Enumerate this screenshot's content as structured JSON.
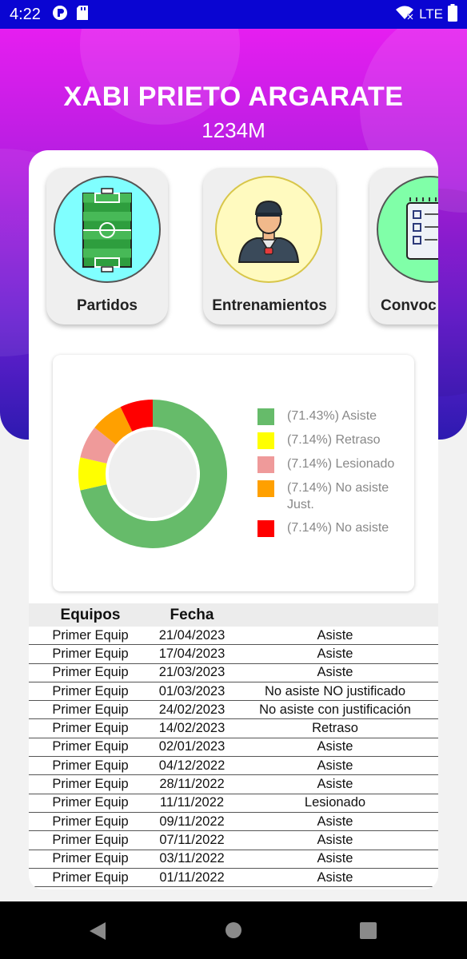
{
  "status_bar": {
    "time": "4:22",
    "network": "LTE",
    "icons": [
      "app-notification-icon",
      "sd-card-icon",
      "wifi-icon",
      "battery-icon"
    ]
  },
  "header": {
    "player_name": "XABI PRIETO ARGARATE",
    "player_code": "1234M",
    "gradient_colors": [
      "#e61ef0",
      "#b21ee0",
      "#6a1fd1",
      "#2d1ab0"
    ]
  },
  "menu": {
    "items": [
      {
        "label": "Partidos",
        "icon": "soccer-field-icon",
        "circle_color": "#80ffff"
      },
      {
        "label": "Entrenamientos",
        "icon": "coach-whistle-icon",
        "circle_color": "#fffabf"
      },
      {
        "label": "Convoc",
        "icon": "checklist-icon",
        "circle_color": "#80ffa8"
      }
    ]
  },
  "chart_data": {
    "type": "pie",
    "categories": [
      "Asiste",
      "Retraso",
      "Lesionado",
      "No asiste Just.",
      "No asiste"
    ],
    "values": [
      71.43,
      7.14,
      7.14,
      7.14,
      7.14
    ],
    "colors": [
      "#66bb6a",
      "#ffff00",
      "#ef9a9a",
      "#ffa000",
      "#ff0000"
    ],
    "legend": [
      "(71.43%) Asiste",
      "(7.14%) Retraso",
      "(7.14%) Lesionado",
      "(7.14%) No asiste Just.",
      "(7.14%) No asiste"
    ],
    "legend_position": "right"
  },
  "table": {
    "headers": [
      "Equipos",
      "Fecha",
      ""
    ],
    "rows": [
      [
        "Primer Equip",
        "21/04/2023",
        "Asiste"
      ],
      [
        "Primer Equip",
        "17/04/2023",
        "Asiste"
      ],
      [
        "Primer Equip",
        "21/03/2023",
        "Asiste"
      ],
      [
        "Primer Equip",
        "01/03/2023",
        "No asiste NO justificado"
      ],
      [
        "Primer Equip",
        "24/02/2023",
        "No asiste con justificación"
      ],
      [
        "Primer Equip",
        "14/02/2023",
        "Retraso"
      ],
      [
        "Primer Equip",
        "02/01/2023",
        "Asiste"
      ],
      [
        "Primer Equip",
        "04/12/2022",
        "Asiste"
      ],
      [
        "Primer Equip",
        "28/11/2022",
        "Asiste"
      ],
      [
        "Primer Equip",
        "11/11/2022",
        "Lesionado"
      ],
      [
        "Primer Equip",
        "09/11/2022",
        "Asiste"
      ],
      [
        "Primer Equip",
        "07/11/2022",
        "Asiste"
      ],
      [
        "Primer Equip",
        "03/11/2022",
        "Asiste"
      ],
      [
        "Primer Equip",
        "01/11/2022",
        "Asiste"
      ]
    ]
  },
  "nav_bar": {
    "buttons": [
      "back-icon",
      "home-icon",
      "recents-icon"
    ]
  }
}
